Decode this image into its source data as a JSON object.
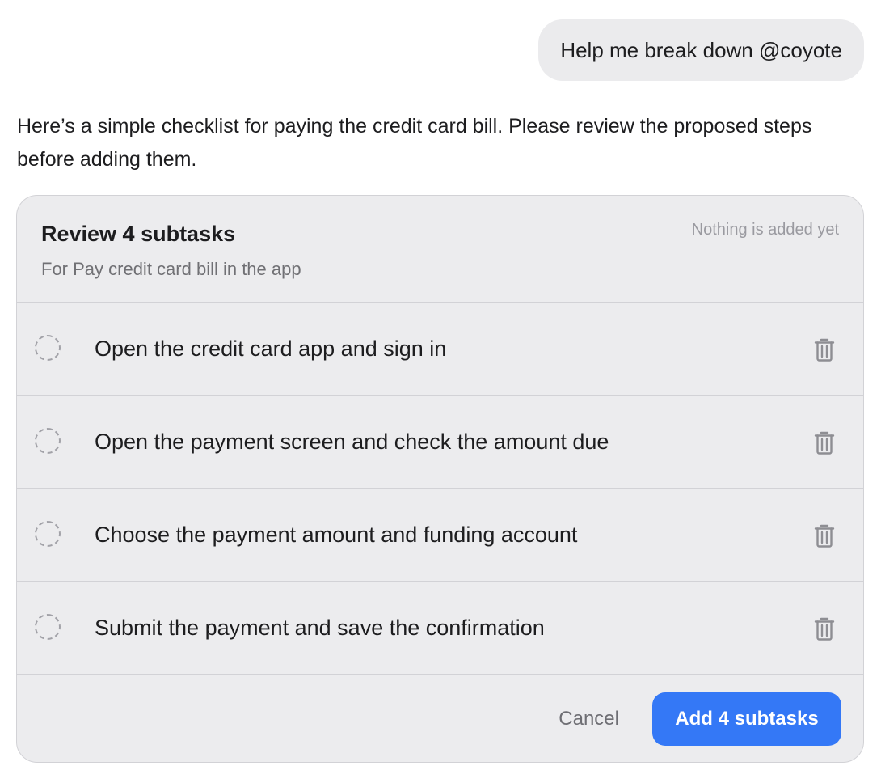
{
  "user_message": {
    "text": "Help me break down @coyote"
  },
  "assistant_message": {
    "text": "Here’s a simple checklist for paying the credit card bill. Please review the proposed steps before adding them."
  },
  "review_card": {
    "title": "Review 4 subtasks",
    "subtitle": "For Pay credit card bill in the app",
    "status": "Nothing is added yet",
    "subtasks": [
      {
        "label": "Open the credit card app and sign in",
        "status_icon": "dashed-circle-icon",
        "delete_icon": "trash-icon"
      },
      {
        "label": "Open the payment screen and check the amount due",
        "status_icon": "dashed-circle-icon",
        "delete_icon": "trash-icon"
      },
      {
        "label": "Choose the payment amount and funding account",
        "status_icon": "dashed-circle-icon",
        "delete_icon": "trash-icon"
      },
      {
        "label": "Submit the payment and save the confirmation",
        "status_icon": "dashed-circle-icon",
        "delete_icon": "trash-icon"
      }
    ],
    "cancel_label": "Cancel",
    "add_label": "Add 4 subtasks"
  },
  "colors": {
    "accent": "#3478f6",
    "card_background": "#ececee",
    "bubble_background": "#ebebed"
  }
}
